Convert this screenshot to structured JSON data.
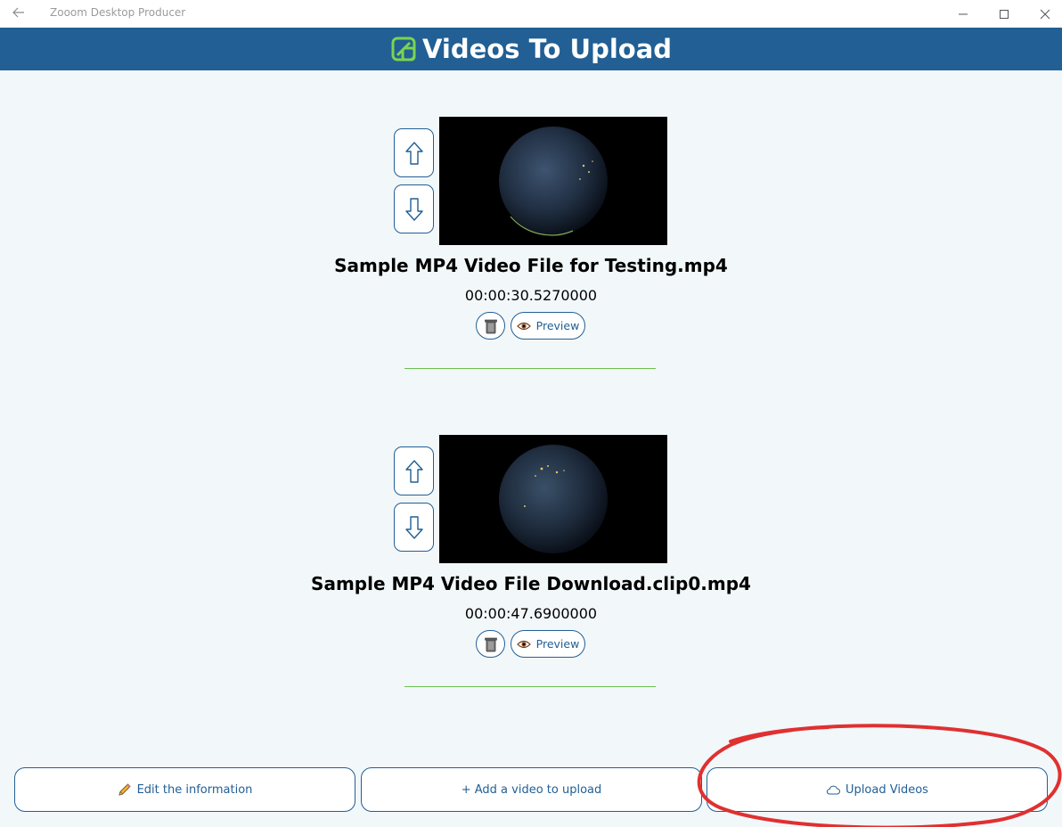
{
  "window": {
    "title": "Zooom Desktop Producer",
    "back_icon": "back-arrow-icon",
    "minimize_icon": "minimize-icon",
    "maximize_icon": "maximize-icon",
    "close_icon": "close-icon"
  },
  "header": {
    "title": "Videos To Upload",
    "logo_icon": "zooom-logo-icon",
    "background": "#215f94",
    "logo_color": "#7cd34f"
  },
  "videos": [
    {
      "filename": "Sample MP4 Video File for Testing.mp4",
      "duration": "00:00:30.5270000",
      "preview_label": "Preview",
      "move_up_icon": "arrow-up-icon",
      "move_down_icon": "arrow-down-icon",
      "delete_icon": "trash-icon",
      "preview_icon": "eye-icon"
    },
    {
      "filename": "Sample MP4 Video File Download.clip0.mp4",
      "duration": "00:00:47.6900000",
      "preview_label": "Preview",
      "move_up_icon": "arrow-up-icon",
      "move_down_icon": "arrow-down-icon",
      "delete_icon": "trash-icon",
      "preview_icon": "eye-icon"
    }
  ],
  "actions": {
    "edit_label": "Edit the information",
    "edit_icon": "pencil-icon",
    "add_label": "+ Add a video to upload",
    "upload_label": "Upload Videos",
    "upload_icon": "cloud-icon"
  },
  "colors": {
    "accent": "#215f94",
    "divider": "#6bbf4e",
    "annotation": "#e03030"
  }
}
